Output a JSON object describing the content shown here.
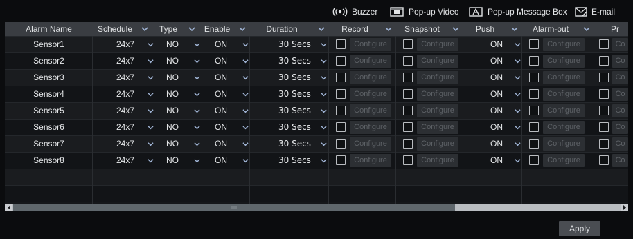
{
  "toolbar": {
    "buzzer_label": "Buzzer",
    "popup_video_label": "Pop-up Video",
    "popup_message_label": "Pop-up Message Box",
    "email_label": "E-mail"
  },
  "columns": [
    {
      "key": "alarm_name",
      "label": "Alarm Name",
      "dropdown": false
    },
    {
      "key": "schedule",
      "label": "Schedule",
      "dropdown": true
    },
    {
      "key": "type",
      "label": "Type",
      "dropdown": true
    },
    {
      "key": "enable",
      "label": "Enable",
      "dropdown": true
    },
    {
      "key": "duration",
      "label": "Duration",
      "dropdown": true
    },
    {
      "key": "record",
      "label": "Record",
      "dropdown": true
    },
    {
      "key": "snapshot",
      "label": "Snapshot",
      "dropdown": true
    },
    {
      "key": "push",
      "label": "Push",
      "dropdown": true
    },
    {
      "key": "alarm_out",
      "label": "Alarm-out",
      "dropdown": true
    },
    {
      "key": "preset",
      "label": "Pr",
      "dropdown": false
    }
  ],
  "configure_label": "Configure",
  "configure_partial_label": "Co",
  "rows": [
    {
      "name": "Sensor1",
      "schedule": "24x7",
      "type": "NO",
      "enable": "ON",
      "duration": "30 Secs",
      "push": "ON"
    },
    {
      "name": "Sensor2",
      "schedule": "24x7",
      "type": "NO",
      "enable": "ON",
      "duration": "30 Secs",
      "push": "ON"
    },
    {
      "name": "Sensor3",
      "schedule": "24x7",
      "type": "NO",
      "enable": "ON",
      "duration": "30 Secs",
      "push": "ON"
    },
    {
      "name": "Sensor4",
      "schedule": "24x7",
      "type": "NO",
      "enable": "ON",
      "duration": "30 Secs",
      "push": "ON"
    },
    {
      "name": "Sensor5",
      "schedule": "24x7",
      "type": "NO",
      "enable": "ON",
      "duration": "30 Secs",
      "push": "ON"
    },
    {
      "name": "Sensor6",
      "schedule": "24x7",
      "type": "NO",
      "enable": "ON",
      "duration": "30 Secs",
      "push": "ON"
    },
    {
      "name": "Sensor7",
      "schedule": "24x7",
      "type": "NO",
      "enable": "ON",
      "duration": "30 Secs",
      "push": "ON"
    },
    {
      "name": "Sensor8",
      "schedule": "24x7",
      "type": "NO",
      "enable": "ON",
      "duration": "30 Secs",
      "push": "ON"
    }
  ],
  "apply_label": "Apply",
  "colors": {
    "header_bg": "#3a3d42",
    "chevron": "#9fb3d4",
    "configure_text": "#5d6166",
    "scroll_thumb": "#5f676c"
  }
}
